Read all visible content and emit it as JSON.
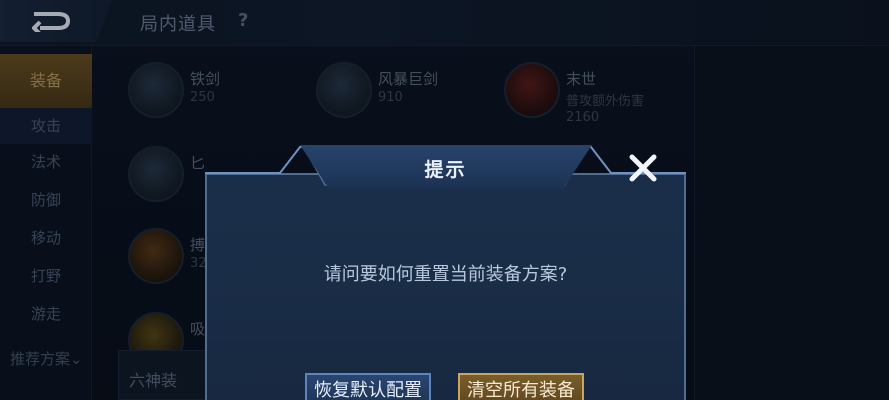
{
  "header": {
    "title": "局内道具",
    "help": "?"
  },
  "sidebar": {
    "items": [
      "装备",
      "攻击",
      "法术",
      "防御",
      "移动",
      "打野",
      "游走"
    ],
    "recommend": "推荐方案"
  },
  "items": [
    {
      "name": "铁剑",
      "price": "250"
    },
    {
      "name": "风暴巨剑",
      "price": "910"
    },
    {
      "name": "末世",
      "sub": "普攻额外伤害",
      "price": "2160"
    },
    {
      "name": "匕",
      "price": ""
    },
    {
      "name": "搏",
      "price": "32"
    },
    {
      "name": "吸",
      "price": ""
    }
  ],
  "six": {
    "label": "六神装"
  },
  "dialog": {
    "title": "提示",
    "message": "请问要如何重置当前装备方案?",
    "btn_default": "恢复默认配置",
    "btn_clear": "清空所有装备"
  },
  "colors": {
    "accent_gold": "#c9a562",
    "accent_blue": "#5e84c0",
    "dialog_bg": "#1a2e4a"
  }
}
